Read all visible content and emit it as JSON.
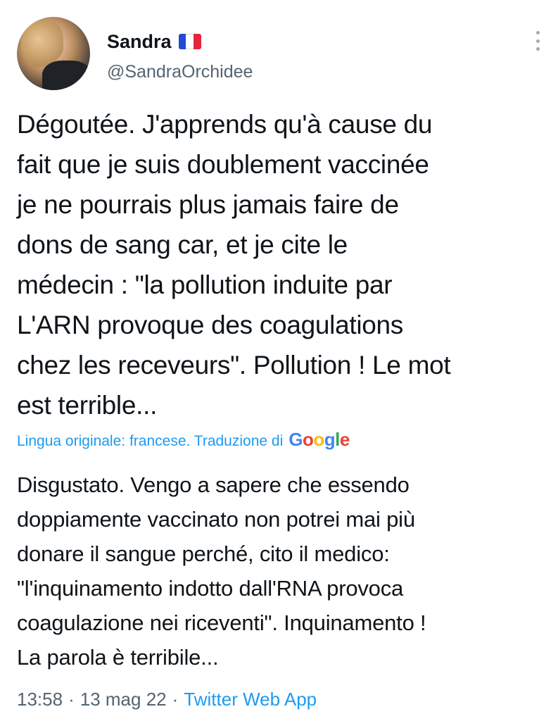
{
  "author": {
    "display_name": "Sandra",
    "handle": "@SandraOrchidee",
    "flag_icon": "france-flag-icon"
  },
  "tweet": {
    "text": "Dégoutée. J'apprends qu'à cause du\nfait que je suis doublement vaccinée\nje ne pourrais plus jamais faire de\ndons de sang car, et je cite le\nmédecin : \"la pollution induite par\nL'ARN provoque des coagulations\nchez les receveurs\". Pollution ! Le mot\nest terrible..."
  },
  "translation": {
    "label": "Lingua originale: francese. Traduzione di",
    "provider": "Google",
    "text": "Disgustato. Vengo a sapere che essendo\ndoppiamente vaccinato non potrei mai più\ndonare il sangue perché, cito il medico:\n\"l'inquinamento indotto dall'RNA provoca\ncoagulazione nei riceventi\". Inquinamento !\nLa parola è terribile..."
  },
  "meta": {
    "time": "13:58",
    "separator": "·",
    "date": "13 mag 22",
    "source": "Twitter Web App"
  },
  "colors": {
    "link_blue": "#1d9bf0",
    "secondary_text": "#536471",
    "primary_text": "#0f1419"
  }
}
